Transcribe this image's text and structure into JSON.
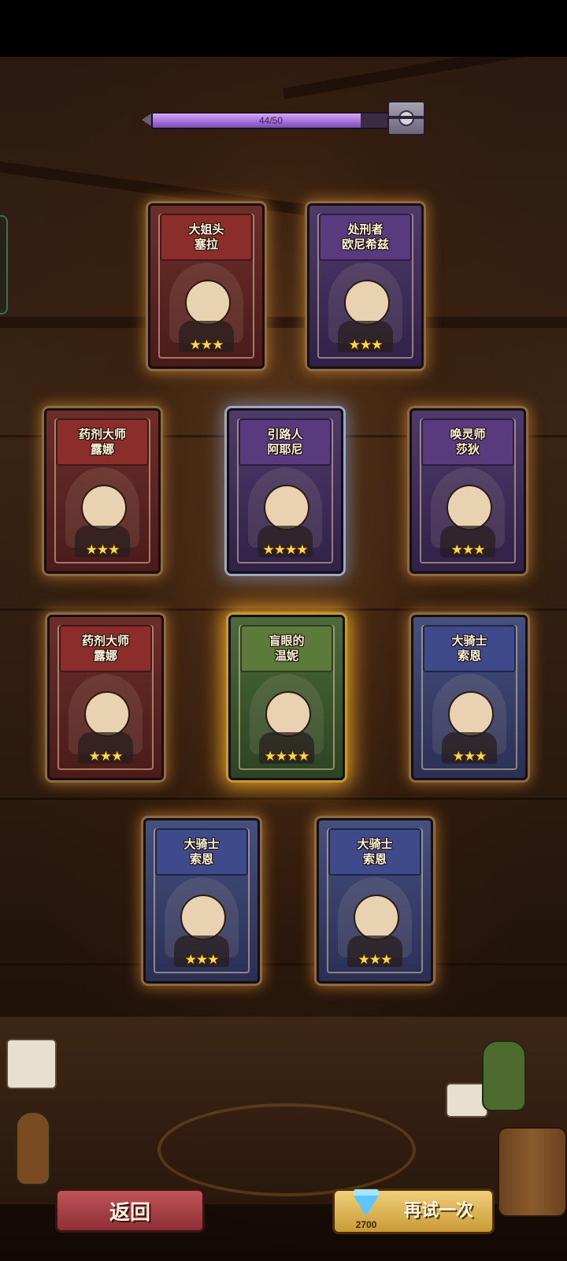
{
  "progress": {
    "text": "44/50",
    "current": 44,
    "max": 50
  },
  "cards": [
    {
      "name_line1": "大姐头",
      "name_line2": "塞拉",
      "stars": "★★★",
      "rarity": "red"
    },
    {
      "name_line1": "处刑者",
      "name_line2": "欧尼希兹",
      "stars": "★★★",
      "rarity": "purple"
    },
    {
      "name_line1": "药剂大师",
      "name_line2": "露娜",
      "stars": "★★★",
      "rarity": "red"
    },
    {
      "name_line1": "引路人",
      "name_line2": "阿耶尼",
      "stars": "★★★★",
      "rarity": "purple"
    },
    {
      "name_line1": "唤灵师",
      "name_line2": "莎狄",
      "stars": "★★★",
      "rarity": "purple"
    },
    {
      "name_line1": "药剂大师",
      "name_line2": "露娜",
      "stars": "★★★",
      "rarity": "red"
    },
    {
      "name_line1": "盲眼的",
      "name_line2": "温妮",
      "stars": "★★★★",
      "rarity": "green"
    },
    {
      "name_line1": "大骑士",
      "name_line2": "索恩",
      "stars": "★★★",
      "rarity": "blue"
    },
    {
      "name_line1": "大骑士",
      "name_line2": "索恩",
      "stars": "★★★",
      "rarity": "blue"
    },
    {
      "name_line1": "大骑士",
      "name_line2": "索恩",
      "stars": "★★★",
      "rarity": "blue"
    }
  ],
  "buttons": {
    "back_label": "返回",
    "retry_label": "再试一次",
    "retry_cost": "2700",
    "retry_cost_icon": "diamond-icon"
  },
  "colors": {
    "progress_fill": "#c08ae8",
    "card_glow": "#ffaa3c",
    "highlight_glow": "#ffb428",
    "star": "#ffd74a"
  }
}
